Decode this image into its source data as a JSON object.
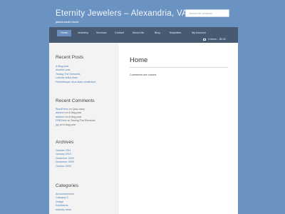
{
  "header": {
    "title": "Eternity Jewelers – Alexandria, VA",
    "tagline": "jadass basic friend",
    "search_placeholder": "Search for products"
  },
  "nav": {
    "items": [
      {
        "label": "Home",
        "active": true
      },
      {
        "label": "Jewelery",
        "active": false
      },
      {
        "label": "Services",
        "active": false
      },
      {
        "label": "Contact",
        "active": false
      },
      {
        "label": "About Me",
        "active": false
      },
      {
        "label": "Blog",
        "active": false
      },
      {
        "label": "Templates",
        "active": false
      },
      {
        "label": "My Account",
        "active": false
      }
    ],
    "cart": "0 items – $0.00"
  },
  "sidebar": {
    "recent_posts": {
      "title": "Recent Posts",
      "items": [
        "A Blog post",
        "Another post",
        "Testing The Elements",
        "Lobortis tellus diam",
        "Pellentesque risus diam vestibulum"
      ]
    },
    "recent_comments": {
      "title": "Recent Comments",
      "items": [
        {
          "author": "WordPress",
          "text": " on Quis crazy"
        },
        {
          "author": "adrianvi",
          "text": " on A blog post"
        },
        {
          "author": "adrianvi",
          "text": " on A blog post"
        },
        {
          "author": "FREDrick",
          "text": " on Testing The Elements"
        },
        {
          "author": "jay",
          "text": " on A blog post"
        }
      ]
    },
    "archives": {
      "title": "Archives",
      "items": [
        "October 2011",
        "January 2010",
        "December 2009",
        "November 2009",
        "October 2009"
      ]
    },
    "categories": {
      "title": "Categories",
      "items": [
        "Announcements",
        "Category 2",
        "Design",
        "Exhibitions",
        "Industry news"
      ]
    }
  },
  "main": {
    "title": "Home",
    "comments_closed": "Comments are closed."
  },
  "colors": {
    "background": "#6b93c2",
    "nav": "#475a72",
    "nav_active": "#6d8fbd",
    "link": "#4f7bb5"
  }
}
